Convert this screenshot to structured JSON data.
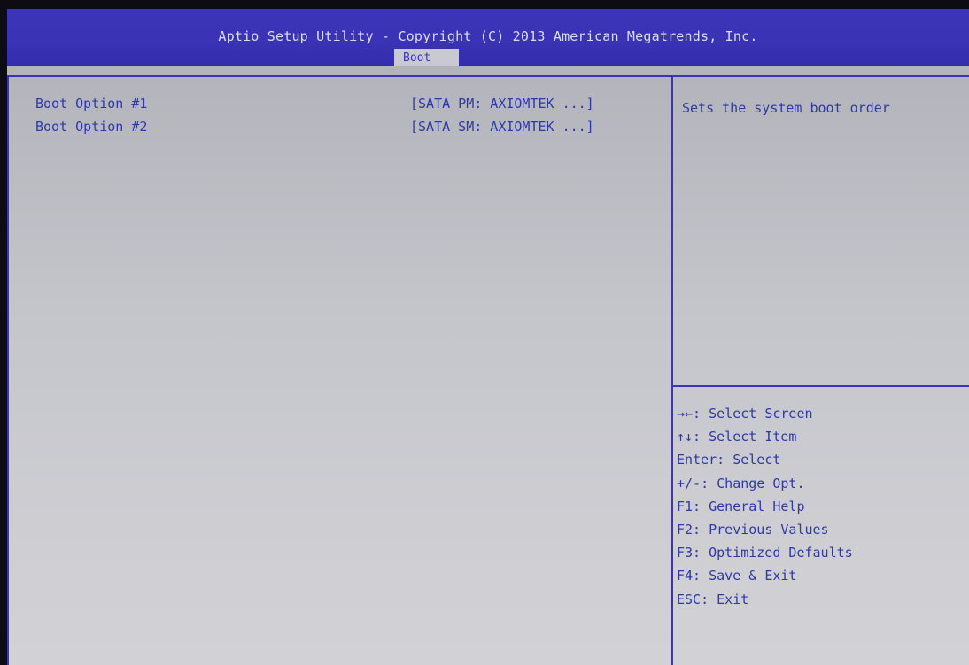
{
  "header": {
    "title": "Aptio Setup Utility - Copyright (C) 2013 American Megatrends, Inc.",
    "active_tab": "Boot"
  },
  "boot_options": [
    {
      "label": "Boot Option #1",
      "value": "[SATA  PM: AXIOMTEK ...]"
    },
    {
      "label": "Boot Option #2",
      "value": "[SATA  SM: AXIOMTEK ...]"
    }
  ],
  "help": {
    "description": "Sets the system boot order",
    "keys": [
      "→←: Select Screen",
      "↑↓: Select Item",
      "Enter: Select",
      "+/-: Change Opt.",
      "F1: General Help",
      "F2: Previous Values",
      "F3: Optimized Defaults",
      "F4: Save & Exit",
      "ESC: Exit"
    ]
  },
  "colors": {
    "accent": "#3b34b8",
    "text": "#2e39a8",
    "background": "#c8c8ce"
  }
}
